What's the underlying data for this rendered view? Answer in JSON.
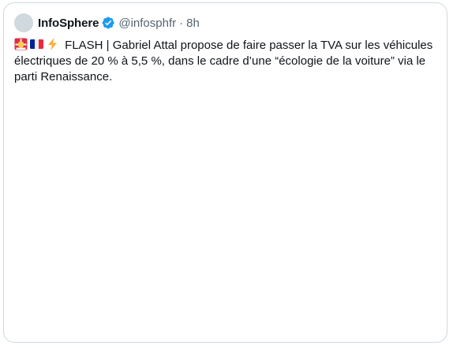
{
  "tweet": {
    "author": {
      "display_name": "InfoSphere",
      "handle": "@infosphfr",
      "verified": true
    },
    "separator": "·",
    "time": "8h",
    "emojis": [
      "rotating-light-icon",
      "france-flag-icon",
      "high-voltage-icon"
    ],
    "text": "FLASH | Gabriel Attal propose de faire passer la TVA sur les véhicules électriques de 20 % à 5,5 %, dans le cadre d’une “écologie de la voiture” via le parti Renaissance."
  },
  "colors": {
    "border": "#cfd9de",
    "text": "#0f1419",
    "muted": "#536471",
    "verified": "#1d9bf0",
    "avatar_placeholder": "#cfd9de"
  }
}
